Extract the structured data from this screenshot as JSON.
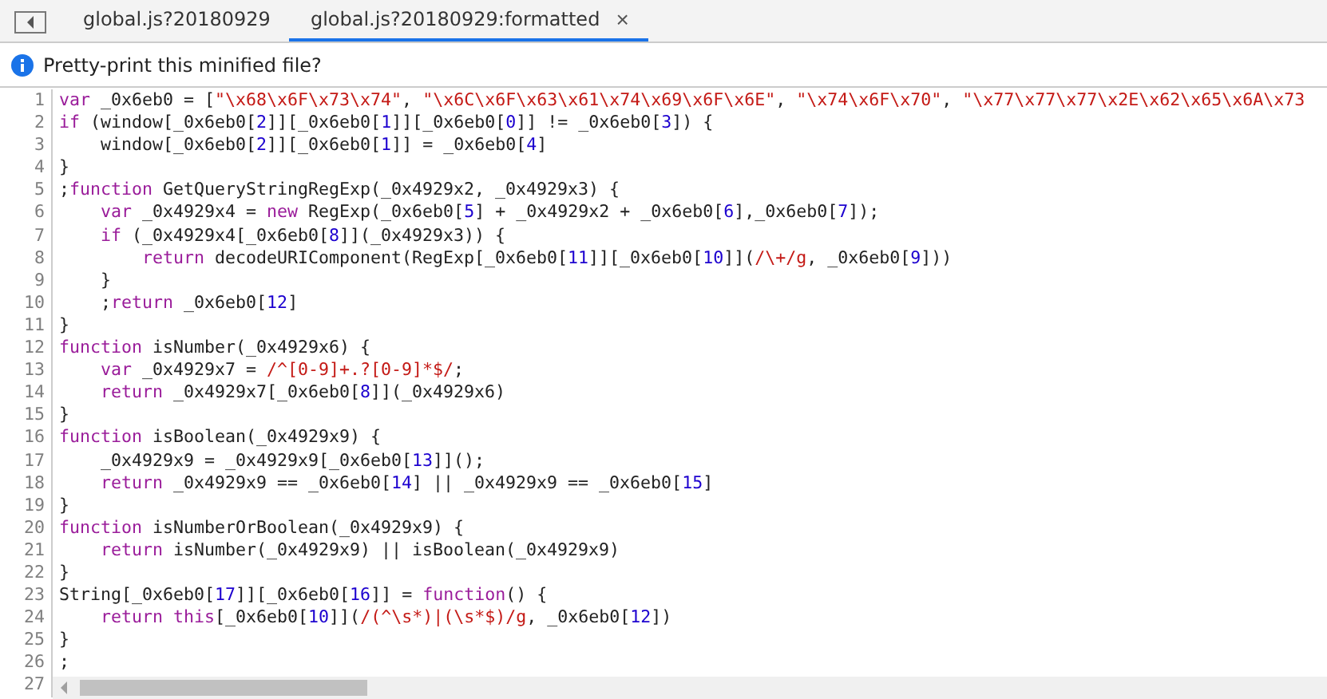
{
  "tabs": [
    {
      "label": "global.js?20180929",
      "selected": false
    },
    {
      "label": "global.js?20180929:formatted",
      "selected": true,
      "close_label": "×"
    }
  ],
  "infobar": {
    "message": "Pretty-print this minified file?"
  },
  "code": {
    "lines": [
      {
        "number": "1",
        "tokens": [
          {
            "kind": "kw",
            "text": "var"
          },
          {
            "kind": "pl",
            "text": " _0x6eb0 = ["
          },
          {
            "kind": "str",
            "text": "\"\\x68\\x6F\\x73\\x74\""
          },
          {
            "kind": "pl",
            "text": ", "
          },
          {
            "kind": "str",
            "text": "\"\\x6C\\x6F\\x63\\x61\\x74\\x69\\x6F\\x6E\""
          },
          {
            "kind": "pl",
            "text": ", "
          },
          {
            "kind": "str",
            "text": "\"\\x74\\x6F\\x70\""
          },
          {
            "kind": "pl",
            "text": ", "
          },
          {
            "kind": "str",
            "text": "\"\\x77\\x77\\x77\\x2E\\x62\\x65\\x6A\\x73"
          }
        ]
      },
      {
        "number": "2",
        "tokens": [
          {
            "kind": "kw",
            "text": "if"
          },
          {
            "kind": "pl",
            "text": " (window[_0x6eb0["
          },
          {
            "kind": "num",
            "text": "2"
          },
          {
            "kind": "pl",
            "text": "]][_0x6eb0["
          },
          {
            "kind": "num",
            "text": "1"
          },
          {
            "kind": "pl",
            "text": "]][_0x6eb0["
          },
          {
            "kind": "num",
            "text": "0"
          },
          {
            "kind": "pl",
            "text": "]] != _0x6eb0["
          },
          {
            "kind": "num",
            "text": "3"
          },
          {
            "kind": "pl",
            "text": "]) {"
          }
        ]
      },
      {
        "number": "3",
        "tokens": [
          {
            "kind": "pl",
            "text": "    window[_0x6eb0["
          },
          {
            "kind": "num",
            "text": "2"
          },
          {
            "kind": "pl",
            "text": "]][_0x6eb0["
          },
          {
            "kind": "num",
            "text": "1"
          },
          {
            "kind": "pl",
            "text": "]] = _0x6eb0["
          },
          {
            "kind": "num",
            "text": "4"
          },
          {
            "kind": "pl",
            "text": "]"
          }
        ]
      },
      {
        "number": "4",
        "tokens": [
          {
            "kind": "pl",
            "text": "}"
          }
        ]
      },
      {
        "number": "5",
        "tokens": [
          {
            "kind": "pl",
            "text": ";"
          },
          {
            "kind": "kw",
            "text": "function"
          },
          {
            "kind": "pl",
            "text": " GetQueryStringRegExp(_0x4929x2, _0x4929x3) {"
          }
        ]
      },
      {
        "number": "6",
        "tokens": [
          {
            "kind": "kw",
            "text": "    var"
          },
          {
            "kind": "pl",
            "text": " _0x4929x4 = "
          },
          {
            "kind": "kw",
            "text": "new"
          },
          {
            "kind": "pl",
            "text": " RegExp(_0x6eb0["
          },
          {
            "kind": "num",
            "text": "5"
          },
          {
            "kind": "pl",
            "text": "] + _0x4929x2 + _0x6eb0["
          },
          {
            "kind": "num",
            "text": "6"
          },
          {
            "kind": "pl",
            "text": "],_0x6eb0["
          },
          {
            "kind": "num",
            "text": "7"
          },
          {
            "kind": "pl",
            "text": "]);"
          }
        ]
      },
      {
        "number": "7",
        "tokens": [
          {
            "kind": "kw",
            "text": "    if"
          },
          {
            "kind": "pl",
            "text": " (_0x4929x4[_0x6eb0["
          },
          {
            "kind": "num",
            "text": "8"
          },
          {
            "kind": "pl",
            "text": "]](_0x4929x3)) {"
          }
        ]
      },
      {
        "number": "8",
        "tokens": [
          {
            "kind": "kw",
            "text": "        return"
          },
          {
            "kind": "pl",
            "text": " decodeURIComponent(RegExp[_0x6eb0["
          },
          {
            "kind": "num",
            "text": "11"
          },
          {
            "kind": "pl",
            "text": "]][_0x6eb0["
          },
          {
            "kind": "num",
            "text": "10"
          },
          {
            "kind": "pl",
            "text": "]]("
          },
          {
            "kind": "re",
            "text": "/\\+/g"
          },
          {
            "kind": "pl",
            "text": ", _0x6eb0["
          },
          {
            "kind": "num",
            "text": "9"
          },
          {
            "kind": "pl",
            "text": "]))"
          }
        ]
      },
      {
        "number": "9",
        "tokens": [
          {
            "kind": "pl",
            "text": "    }"
          }
        ]
      },
      {
        "number": "10",
        "tokens": [
          {
            "kind": "pl",
            "text": "    ;"
          },
          {
            "kind": "kw",
            "text": "return"
          },
          {
            "kind": "pl",
            "text": " _0x6eb0["
          },
          {
            "kind": "num",
            "text": "12"
          },
          {
            "kind": "pl",
            "text": "]"
          }
        ]
      },
      {
        "number": "11",
        "tokens": [
          {
            "kind": "pl",
            "text": "}"
          }
        ]
      },
      {
        "number": "12",
        "tokens": [
          {
            "kind": "kw",
            "text": "function"
          },
          {
            "kind": "pl",
            "text": " isNumber(_0x4929x6) {"
          }
        ]
      },
      {
        "number": "13",
        "tokens": [
          {
            "kind": "kw",
            "text": "    var"
          },
          {
            "kind": "pl",
            "text": " _0x4929x7 = "
          },
          {
            "kind": "re",
            "text": "/^[0-9]+.?[0-9]*$/"
          },
          {
            "kind": "pl",
            "text": ";"
          }
        ]
      },
      {
        "number": "14",
        "tokens": [
          {
            "kind": "kw",
            "text": "    return"
          },
          {
            "kind": "pl",
            "text": " _0x4929x7[_0x6eb0["
          },
          {
            "kind": "num",
            "text": "8"
          },
          {
            "kind": "pl",
            "text": "]](_0x4929x6)"
          }
        ]
      },
      {
        "number": "15",
        "tokens": [
          {
            "kind": "pl",
            "text": "}"
          }
        ]
      },
      {
        "number": "16",
        "tokens": [
          {
            "kind": "kw",
            "text": "function"
          },
          {
            "kind": "pl",
            "text": " isBoolean(_0x4929x9) {"
          }
        ]
      },
      {
        "number": "17",
        "tokens": [
          {
            "kind": "pl",
            "text": "    _0x4929x9 = _0x4929x9[_0x6eb0["
          },
          {
            "kind": "num",
            "text": "13"
          },
          {
            "kind": "pl",
            "text": "]]();"
          }
        ]
      },
      {
        "number": "18",
        "tokens": [
          {
            "kind": "kw",
            "text": "    return"
          },
          {
            "kind": "pl",
            "text": " _0x4929x9 == _0x6eb0["
          },
          {
            "kind": "num",
            "text": "14"
          },
          {
            "kind": "pl",
            "text": "] || _0x4929x9 == _0x6eb0["
          },
          {
            "kind": "num",
            "text": "15"
          },
          {
            "kind": "pl",
            "text": "]"
          }
        ]
      },
      {
        "number": "19",
        "tokens": [
          {
            "kind": "pl",
            "text": "}"
          }
        ]
      },
      {
        "number": "20",
        "tokens": [
          {
            "kind": "kw",
            "text": "function"
          },
          {
            "kind": "pl",
            "text": " isNumberOrBoolean(_0x4929x9) {"
          }
        ]
      },
      {
        "number": "21",
        "tokens": [
          {
            "kind": "kw",
            "text": "    return"
          },
          {
            "kind": "pl",
            "text": " isNumber(_0x4929x9) || isBoolean(_0x4929x9)"
          }
        ]
      },
      {
        "number": "22",
        "tokens": [
          {
            "kind": "pl",
            "text": "}"
          }
        ]
      },
      {
        "number": "23",
        "tokens": [
          {
            "kind": "pl",
            "text": "String[_0x6eb0["
          },
          {
            "kind": "num",
            "text": "17"
          },
          {
            "kind": "pl",
            "text": "]][_0x6eb0["
          },
          {
            "kind": "num",
            "text": "16"
          },
          {
            "kind": "pl",
            "text": "]] = "
          },
          {
            "kind": "kw",
            "text": "function"
          },
          {
            "kind": "pl",
            "text": "() {"
          }
        ]
      },
      {
        "number": "24",
        "tokens": [
          {
            "kind": "kw",
            "text": "    return this"
          },
          {
            "kind": "pl",
            "text": "[_0x6eb0["
          },
          {
            "kind": "num",
            "text": "10"
          },
          {
            "kind": "pl",
            "text": "]]("
          },
          {
            "kind": "re",
            "text": "/(^\\s*)|(\\s*$)/g"
          },
          {
            "kind": "pl",
            "text": ", _0x6eb0["
          },
          {
            "kind": "num",
            "text": "12"
          },
          {
            "kind": "pl",
            "text": "])"
          }
        ]
      },
      {
        "number": "25",
        "tokens": [
          {
            "kind": "pl",
            "text": "}"
          }
        ]
      },
      {
        "number": "26",
        "tokens": [
          {
            "kind": "pl",
            "text": ";"
          }
        ]
      },
      {
        "number": "27"
      }
    ]
  }
}
